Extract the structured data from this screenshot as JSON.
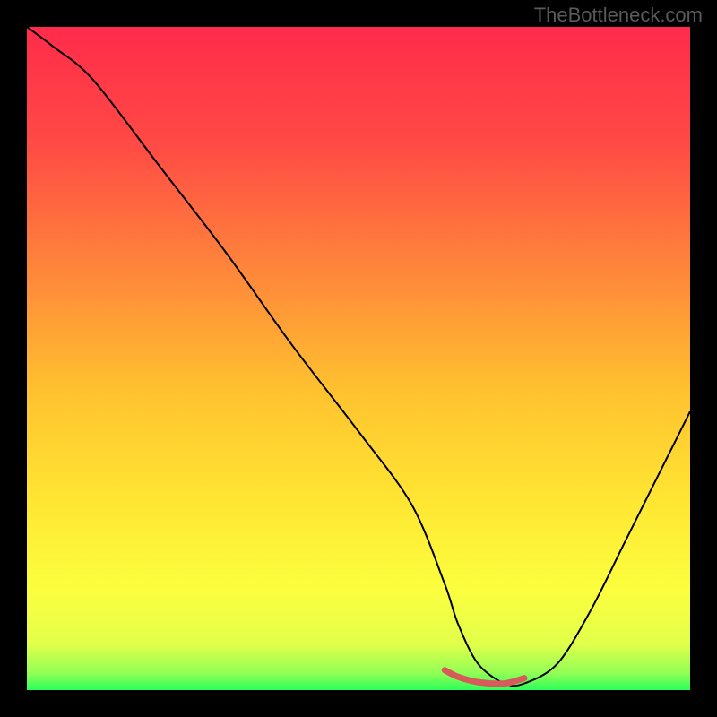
{
  "watermark": "TheBottleneck.com",
  "chart_data": {
    "type": "line",
    "title": "",
    "xlabel": "",
    "ylabel": "",
    "xlim": [
      0,
      100
    ],
    "ylim": [
      0,
      100
    ],
    "grid": false,
    "series": [
      {
        "name": "curve",
        "x": [
          0,
          4,
          10,
          20,
          30,
          40,
          50,
          58,
          63,
          65,
          68,
          72,
          75,
          80,
          85,
          90,
          95,
          100
        ],
        "y": [
          100,
          97,
          92,
          79,
          66,
          52,
          39,
          28,
          16,
          10,
          4,
          1,
          1,
          4,
          12,
          22,
          32,
          42
        ],
        "color": "#000000",
        "width": 2
      },
      {
        "name": "highlight",
        "x": [
          63,
          65,
          68,
          72,
          75
        ],
        "y": [
          3.0,
          2.0,
          1.2,
          1.0,
          1.8
        ],
        "color": "#d85a5a",
        "width": 7
      }
    ],
    "background_gradient": {
      "stops": [
        {
          "offset": 0.0,
          "color": "#ff2b4a"
        },
        {
          "offset": 0.18,
          "color": "#ff4b45"
        },
        {
          "offset": 0.38,
          "color": "#ff8a3a"
        },
        {
          "offset": 0.55,
          "color": "#ffc22f"
        },
        {
          "offset": 0.72,
          "color": "#ffe733"
        },
        {
          "offset": 0.85,
          "color": "#fbff3e"
        },
        {
          "offset": 0.93,
          "color": "#e2ff4a"
        },
        {
          "offset": 0.975,
          "color": "#90ff55"
        },
        {
          "offset": 1.0,
          "color": "#2bff5a"
        }
      ]
    }
  }
}
